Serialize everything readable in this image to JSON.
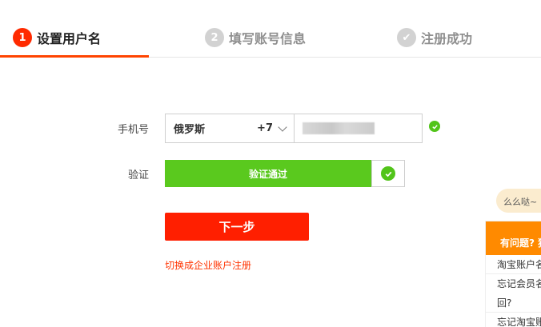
{
  "steps": [
    {
      "num": "1",
      "label": "设置用户名",
      "state": "active"
    },
    {
      "num": "2",
      "label": "填写账号信息",
      "state": "pending"
    },
    {
      "num": "✔",
      "label": "注册成功",
      "state": "pending"
    }
  ],
  "form": {
    "phone_label": "手机号",
    "country": {
      "name": "俄罗斯",
      "code": "+7"
    },
    "verify_label": "验证",
    "verify_status": "验证通过",
    "next_button": "下一步",
    "switch_link": "切换成企业账户注册"
  },
  "help": {
    "bubble": "么么哒~",
    "title": "有问题? 独",
    "items": [
      "淘宝账户名",
      "忘记会员名",
      "回?",
      "忘记淘宝账"
    ]
  },
  "colors": {
    "accent": "#ff4400",
    "success": "#5ac91e",
    "button": "#ff1f00",
    "help_header": "#ff8a00"
  }
}
